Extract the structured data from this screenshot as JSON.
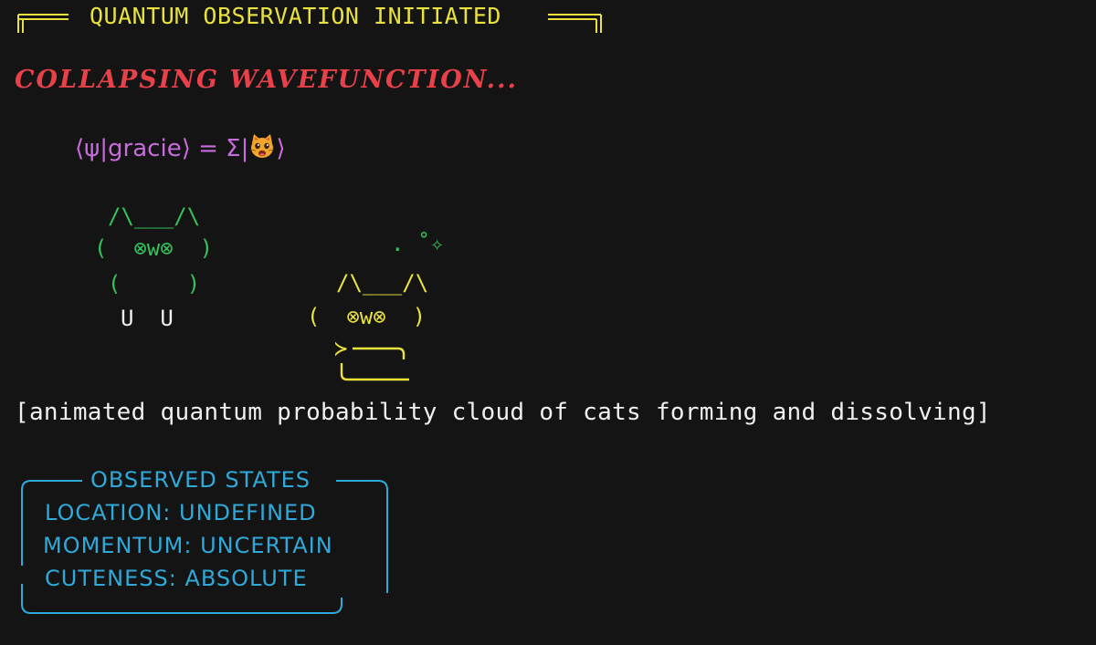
{
  "header": {
    "title": "QUANTUM OBSERVATION INITIATED"
  },
  "status": {
    "collapsing": "COLLAPSING WAVEFUNCTION..."
  },
  "equation": {
    "prefix": "⟨ψ|gracie⟩ = Σ|",
    "suffix": "⟩",
    "face_icon": "cat-face-emoji"
  },
  "cat_green": {
    "ears": "/\\___/\\",
    "face": "(  ⊗w⊗  )",
    "body": "(     )",
    "paws": "U  U"
  },
  "cat_yellow": {
    "sparkle": ". ˚✧",
    "ears": "/\\___/\\",
    "face": "(  ⊗w⊗  )",
    "arrow": "≻"
  },
  "caption": "[animated quantum probability cloud of cats forming and dissolving]",
  "observed_states": {
    "title": "OBSERVED STATES",
    "lines": [
      "LOCATION: UNDEFINED",
      "MOMENTUM: UNCERTAIN",
      "CUTENESS: ABSOLUTE"
    ]
  },
  "colors": {
    "background": "#141414",
    "header": "#e9e23c",
    "collapse": "#e8414a",
    "equation": "#c86bdb",
    "cat_green": "#35c25a",
    "cat_yellow": "#e9e23c",
    "caption": "#f0f0f0",
    "box": "#2fa9d9"
  }
}
